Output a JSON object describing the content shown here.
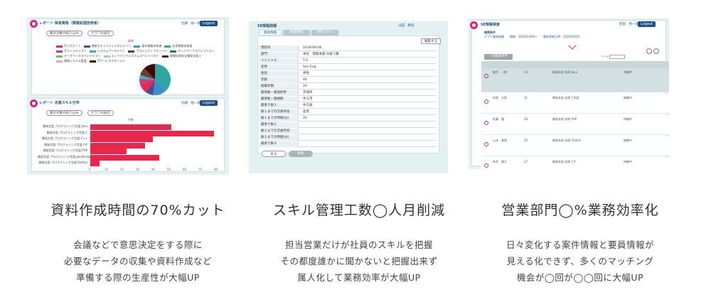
{
  "features": [
    {
      "heading": "資料作成時間の70%カット",
      "description": [
        "会議などで意思決定をする際に",
        "必要なデータの収集や資料作成など",
        "準備する際の生産性が大幅UP"
      ]
    },
    {
      "heading": "スキル管理工数◯人月削減",
      "description": [
        "担当営業だけが社員のスキルを把握",
        "その都度誰かに聞かないと把握出来ず",
        "属人化して業務効率が大幅UP"
      ]
    },
    {
      "heading": "営業部門◯%業務効率化",
      "description": [
        "日々変化する案件情報と要員情報が",
        "見える化できず、多くのマッチング",
        "機会が◯回が◯◯回に大幅UP"
      ]
    }
  ],
  "shot1": {
    "panel_top_title": "レポート 保有資格（情報処理技術者）",
    "panel_bottom_title": "レポート 言語スキル分布",
    "user": "佐藤　裕一郎",
    "logout": "Logout",
    "btn_aggregate": "集計対象の絞り込み",
    "btn_graph": "グラフの表示",
    "pie_title": "資格",
    "bar_title": "件数",
    "legend": [
      {
        "label": "ITパスポート",
        "color": "#e8274c"
      },
      {
        "label": "情報セキュリティマネジメント",
        "color": "#4b4b9c"
      },
      {
        "label": "基本情報技術者",
        "color": "#3d8fc9"
      },
      {
        "label": "応用情報技術者",
        "color": "#2fa6a0"
      },
      {
        "label": "ITストラテジスト",
        "color": "#c43a8c"
      },
      {
        "label": "システムアーキテクト",
        "color": "#2bb5c4"
      },
      {
        "label": "プロジェクトマネージャ",
        "color": "#6b3d2a"
      },
      {
        "label": "ネットワークスペシャリスト",
        "color": "#2a7f3e"
      },
      {
        "label": "データベーススペシャリスト",
        "color": "#7fbf3f"
      },
      {
        "label": "エンベデッドシステムスペシャリスト",
        "color": "#9fd6c0"
      },
      {
        "label": "情報処理安全確保支援士",
        "color": "#5a1a1a"
      },
      {
        "label": "情報システム監査",
        "color": "#f0a0b4"
      },
      {
        "label": "ITサービスマネージャ",
        "color": "#3a0a0a"
      }
    ],
    "pie": [
      {
        "value": 38,
        "color": "#2fa6a0"
      },
      {
        "value": 14,
        "color": "#3d8fc9"
      },
      {
        "value": 8,
        "color": "#4b4b9c"
      },
      {
        "value": 10,
        "color": "#e8274c"
      },
      {
        "value": 6,
        "color": "#c43a8c"
      },
      {
        "value": 4,
        "color": "#2bb5c4"
      },
      {
        "value": 8,
        "color": "#6b3d2a"
      },
      {
        "value": 12,
        "color": "#3a0a0a"
      }
    ],
    "bars": [
      {
        "label": "開発言語 プログラミング言語 Java",
        "value": 52
      },
      {
        "label": "開発言語 プログラミング言語 C",
        "value": 79
      },
      {
        "label": "開発言語 プログラミング言語 C++",
        "value": 40
      },
      {
        "label": "開発言語 プログラミング言語 C#",
        "value": 35
      },
      {
        "label": "開発言語 プログラミング言語 PHP",
        "value": 23
      },
      {
        "label": "開発言語 プログラミング言語 JavaScript",
        "value": 44
      },
      {
        "label": "開発言語 プログラミング言語 Python",
        "value": 6
      }
    ],
    "axis_ticks": [
      "0",
      "10",
      "20",
      "30",
      "40",
      "50",
      "60",
      "70",
      "80"
    ]
  },
  "shot2": {
    "title": "SE情報詳細",
    "user": "山田　勝浩",
    "tabs": [
      "基本情報",
      "経歴情報",
      "保有スキル"
    ],
    "edit": "編集する",
    "rows": [
      {
        "k": "更新日",
        "v": "2018/09/28"
      },
      {
        "k": "部門",
        "v": "本社　開発本部 SI部 1課"
      },
      {
        "k": "イニシャル",
        "v": "T.U"
      },
      {
        "k": "名称",
        "v": "Smi Eng"
      },
      {
        "k": "性別",
        "v": "男性"
      },
      {
        "k": "年齢",
        "v": "46"
      },
      {
        "k": "経験年数",
        "v": "24"
      },
      {
        "k": "最寄駅・都道府県",
        "v": "茨城県"
      },
      {
        "k": "最寄駅・路線駅",
        "v": "牛久市"
      },
      {
        "k": "最寄り駅１",
        "v": "牛久駅"
      },
      {
        "k": "駅１までの交通手段",
        "v": "徒歩"
      },
      {
        "k": "駅１までの時間(分)",
        "v": "20"
      },
      {
        "k": "最寄り駅２",
        "v": ""
      },
      {
        "k": "駅２までの交通手段",
        "v": ""
      },
      {
        "k": "駅２までの時間(分)",
        "v": ""
      },
      {
        "k": "最寄り駅３",
        "v": ""
      }
    ],
    "btn_back": "戻る",
    "btn_update": "更新"
  },
  "shot3": {
    "title": "SE情報検索",
    "user": "新田　恵一郎",
    "logout": "Logout",
    "cond_label": "検索条件",
    "cond_text": "アプリ開発経験　　期間　2020/10/09〜　　最終更新日時　2020/09/20",
    "btn_search": "一括検索条件",
    "sort_label": "ソート",
    "rows": [
      {
        "name": "総合　一郎",
        "age": "24",
        "dept": "開発本部 技術 Java",
        "st": "待機中"
      },
      {
        "name": "技術　太郎",
        "age": "31",
        "dept": "開発本部 技術 C言語",
        "st": "稼働中"
      },
      {
        "name": "佐藤　健",
        "age": "28",
        "dept": "開発本部 技術 PHP",
        "st": "待機中"
      },
      {
        "name": "山本　美咲",
        "age": "35",
        "dept": "開発本部 技術 Python",
        "st": "稼働中"
      },
      {
        "name": "新井　雄大",
        "age": "27",
        "dept": "開発本部 技術 C#",
        "st": "待機中"
      }
    ]
  }
}
